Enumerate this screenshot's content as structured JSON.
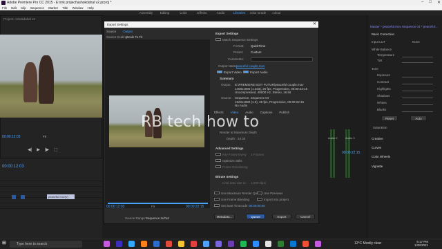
{
  "app": {
    "title": "Adobe Premiere Pro CC 2015 - E:\\rnk project\\ashokdahal v2.prproj *"
  },
  "menubar": [
    "File",
    "Edit",
    "Clip",
    "Sequence",
    "Marker",
    "Title",
    "Window",
    "Help"
  ],
  "workspaces": [
    {
      "label": "Assembly",
      "active": false
    },
    {
      "label": "Editing",
      "active": false
    },
    {
      "label": "Color",
      "active": false
    },
    {
      "label": "Effects",
      "active": false
    },
    {
      "label": "Audio",
      "active": false
    },
    {
      "label": "Libraries",
      "active": true
    },
    {
      "label": "color Grade",
      "active": false
    },
    {
      "label": "colour",
      "active": false
    }
  ],
  "dialog": {
    "title": "Export Settings",
    "tabs": [
      {
        "label": "Source",
        "active": false
      },
      {
        "label": "Output",
        "active": true
      }
    ],
    "source_scaling_label": "Source Scaling:",
    "source_scaling_value": "Scale To Fit",
    "export_settings_heading": "Export Settings",
    "match_sequence": "Match Sequence Settings",
    "format_label": "Format:",
    "format_value": "QuickTime",
    "preset_label": "Preset:",
    "preset_value": "Custom",
    "comments_label": "Comments:",
    "output_name_label": "Output Name:",
    "output_name_value": "peaceful couple.mov",
    "export_video": "Export Video",
    "export_audio": "Export Audio",
    "summary_heading": "Summary",
    "summary_output_label": "Output:",
    "summary_output_text": "E:\\PREMIERE EDIT FUTUR\\peaceful couple.mov\n1408x1080 (1.333), 25 fps, Progressive, 00:00:22:15\nUncompressed, 48000 Hz, Stereo, 16 bit",
    "summary_source_label": "Source:",
    "summary_source_text": "Sequence, Sequence 04\n1920x1080 (1.0), 25 fps, Progressive, 00:00:22:15\nNo Audio",
    "sub_tabs": [
      {
        "label": "Effects",
        "active": false
      },
      {
        "label": "Video",
        "active": true
      },
      {
        "label": "Audio",
        "active": false
      },
      {
        "label": "Captions",
        "active": false
      },
      {
        "label": "Publish",
        "active": false
      }
    ],
    "render_max_depth": "Render at Maximum Depth",
    "depth_label": "Depth:",
    "depth_value": "24 bit",
    "advanced_heading": "Advanced Settings",
    "key_frame": "Key Frame Every:",
    "key_frame_value": "1 Frames",
    "optimize_stills": "Optimize Stills",
    "frame_reordering": "Frame Reordering",
    "bitrate_heading": "Bitrate Settings",
    "limit_data_rate": "Limit data rate to:",
    "limit_data_rate_value": "1,000 kbps",
    "use_max_render": "Use Maximum Render Quality",
    "use_previews": "Use Previews",
    "use_frame_blending": "Use Frame Blending",
    "import_into_project": "Import into project",
    "set_start_timecode": "Set Start Timecode",
    "start_timecode": "00:00:00:00",
    "timecode_in": "00:00:12:03",
    "timecode_out": "00:00:22:15",
    "fit_label": "Fit",
    "source_range_label": "Source Range:",
    "source_range_value": "Sequence In/Out",
    "buttons": {
      "metadata": "Metadata...",
      "queue": "Queue",
      "export": "Export",
      "cancel": "Cancel"
    }
  },
  "left": {
    "tab": "Project: Ashokdahal v2",
    "timecode_program": "00:00:12:03",
    "timeline_timecode": "00:00:12:03",
    "clip_label": "peaceful.mov[V]",
    "fit": "Fit"
  },
  "mid": {
    "meter_labels": [
      "-6",
      "-12",
      "-18",
      "-24",
      "-30",
      "-36",
      "-42",
      "-48",
      "-54"
    ],
    "audio_labels": [
      "Audio 2",
      "Audio 3"
    ],
    "end_timecode": "00:00:22:15"
  },
  "right": {
    "header": "Master * peaceful.mov  Sequence 04 * peaceful...",
    "basic_correction": "Basic Correction",
    "input_lut": "Input LUT",
    "input_lut_value": "None",
    "white_balance": "White Balance",
    "temperature": "Temperature",
    "tint": "Tint",
    "tone": "Tone",
    "exposure": "Exposure",
    "contrast": "Contrast",
    "highlights": "Highlights",
    "shadows": "Shadows",
    "whites": "Whites",
    "blacks": "Blacks",
    "reset": "Reset",
    "auto": "Auto",
    "saturation": "Saturation",
    "creative": "Creative",
    "curves": "Curves",
    "color_wheels": "Color Wheels",
    "vignette": "Vignette"
  },
  "taskbar": {
    "search_placeholder": "Type here to search",
    "weather": "12°C  Mostly clear",
    "time": "9:17 PM",
    "date": "1/28/2021"
  },
  "overlay": {
    "watermark": "RB tech how to"
  },
  "colors": {
    "accent": "#4aa3ff",
    "queue": "#2d5a9e",
    "panel": "#232323"
  }
}
